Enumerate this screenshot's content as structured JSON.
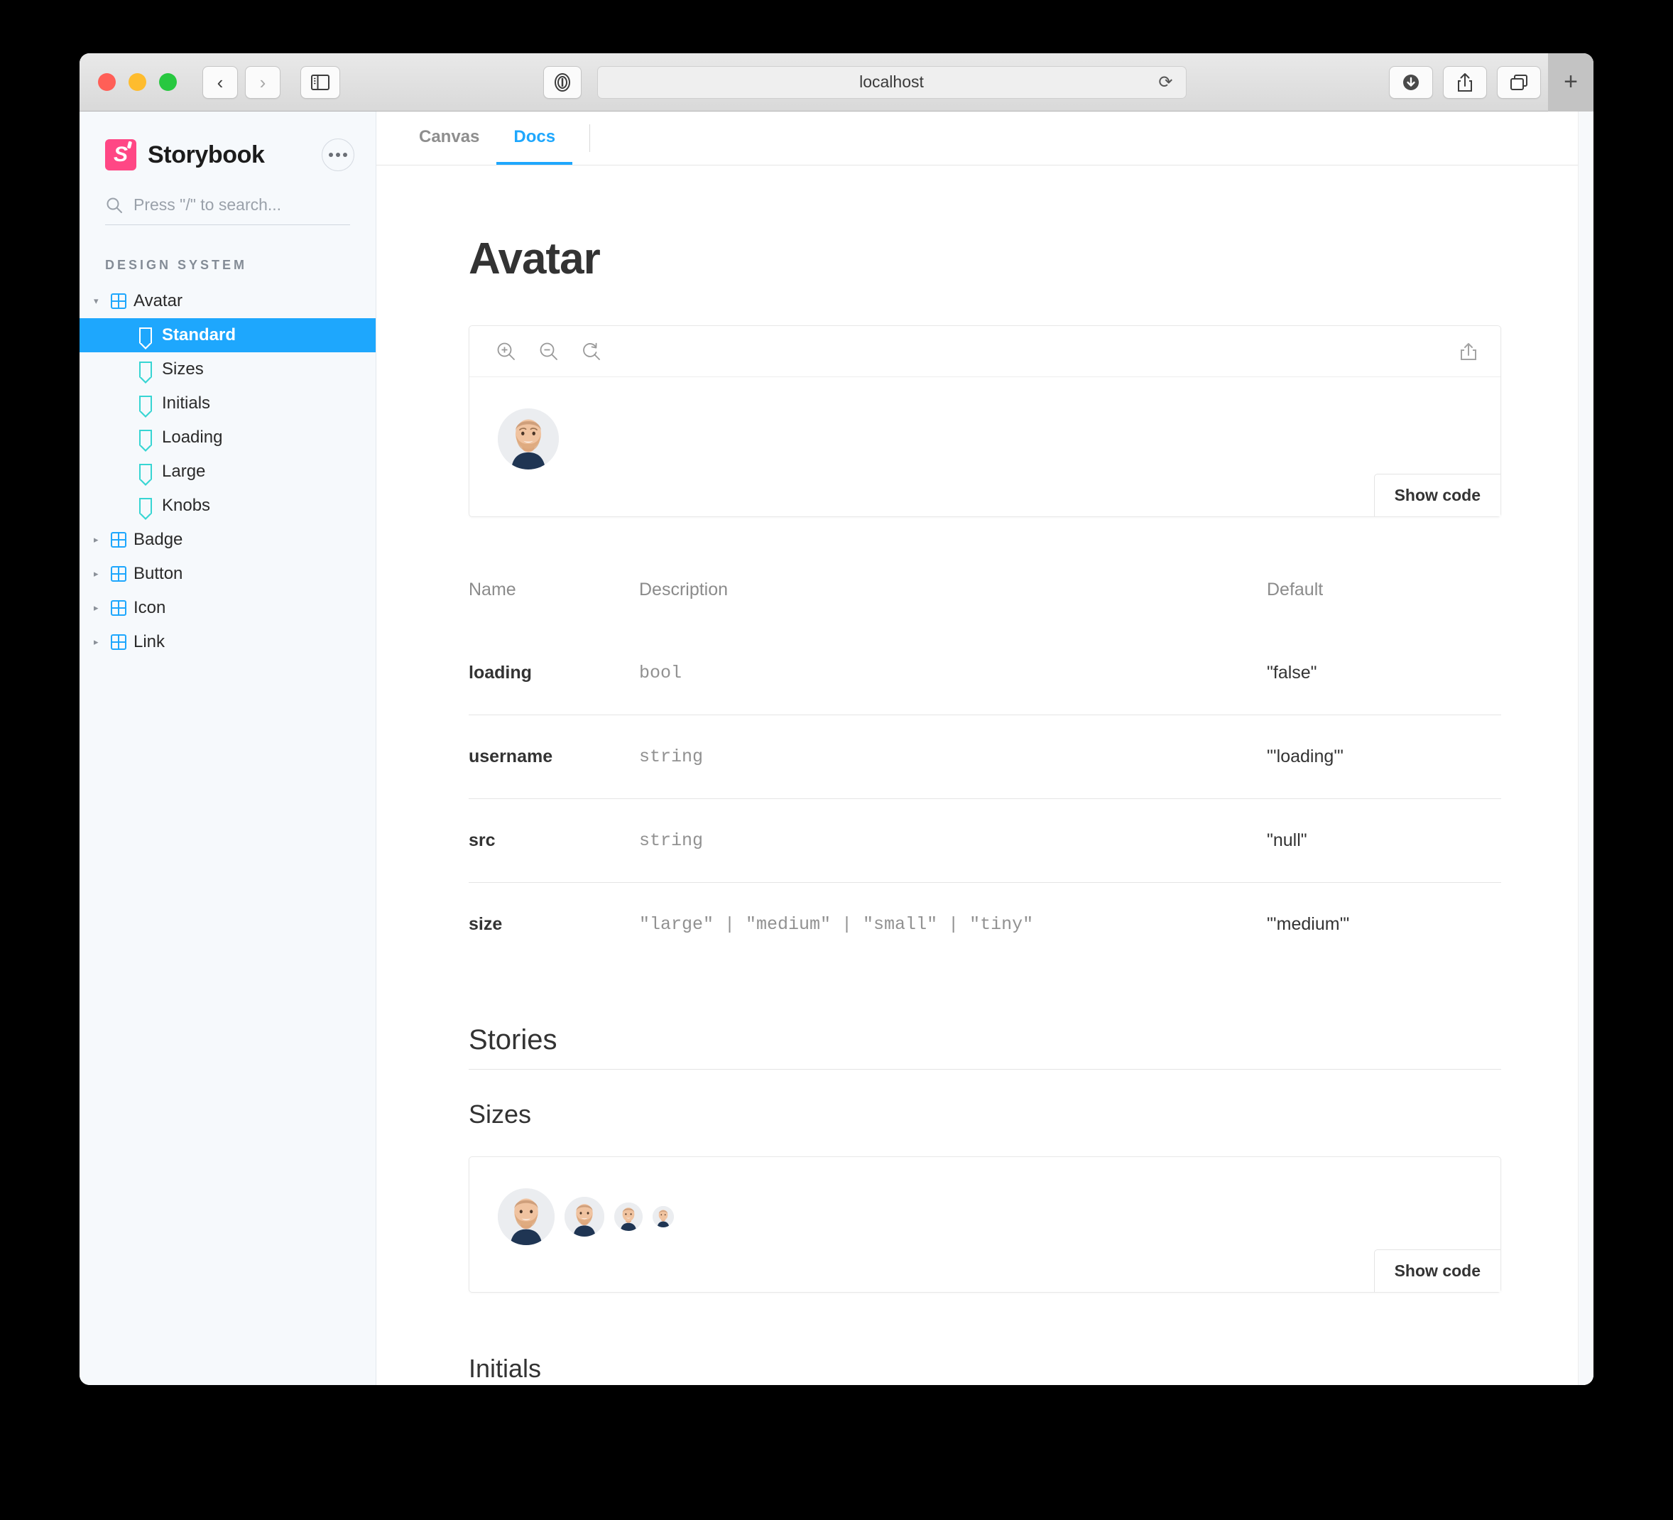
{
  "browser": {
    "url": "localhost",
    "traffic_lights": [
      "close",
      "minimize",
      "maximize"
    ],
    "back_label": "‹",
    "forward_label": "›",
    "reload_label": "⟳",
    "new_tab_label": "+",
    "icons": {
      "sidebar": "sidebar-toggle-icon",
      "reader": "reader-view-icon",
      "downloads": "downloads-icon",
      "share": "share-icon",
      "tabs": "tab-overview-icon"
    }
  },
  "sidebar": {
    "brand": "Storybook",
    "logo_letter": "S",
    "more_label": "•••",
    "search_placeholder": "Press \"/\" to search...",
    "section_label": "DESIGN SYSTEM",
    "tree": [
      {
        "label": "Avatar",
        "type": "group",
        "expanded": true,
        "arrow": "▾"
      },
      {
        "label": "Standard",
        "type": "story",
        "selected": true
      },
      {
        "label": "Sizes",
        "type": "story",
        "selected": false
      },
      {
        "label": "Initials",
        "type": "story",
        "selected": false
      },
      {
        "label": "Loading",
        "type": "story",
        "selected": false
      },
      {
        "label": "Large",
        "type": "story",
        "selected": false
      },
      {
        "label": "Knobs",
        "type": "story",
        "selected": false
      },
      {
        "label": "Badge",
        "type": "group",
        "expanded": false,
        "arrow": "▸"
      },
      {
        "label": "Button",
        "type": "group",
        "expanded": false,
        "arrow": "▸"
      },
      {
        "label": "Icon",
        "type": "group",
        "expanded": false,
        "arrow": "▸"
      },
      {
        "label": "Link",
        "type": "group",
        "expanded": false,
        "arrow": "▸"
      }
    ]
  },
  "main": {
    "tabs": [
      {
        "label": "Canvas",
        "active": false
      },
      {
        "label": "Docs",
        "active": true
      }
    ],
    "doc_title": "Avatar",
    "preview": {
      "zoom_in": "zoom-in",
      "zoom_out": "zoom-out",
      "zoom_reset": "zoom-reset",
      "open_external": "open-in-new",
      "show_code_label": "Show code"
    },
    "props_table": {
      "headers": [
        "Name",
        "Description",
        "Default"
      ],
      "rows": [
        {
          "name": "loading",
          "description": "bool",
          "default": "\"false\""
        },
        {
          "name": "username",
          "description": "string",
          "default": "\"'loading'\""
        },
        {
          "name": "src",
          "description": "string",
          "default": "\"null\""
        },
        {
          "name": "size",
          "description": "\"large\" | \"medium\" | \"small\" | \"tiny\"",
          "default": "\"'medium'\""
        }
      ]
    },
    "stories_heading": "Stories",
    "stories": [
      {
        "heading": "Sizes",
        "show_code_label": "Show code"
      },
      {
        "heading": "Initials"
      }
    ]
  },
  "colors": {
    "accent": "#1ea7fd",
    "brand": "#ff4785",
    "story_icon": "#37d5d3",
    "sidebar_bg": "#f6f9fc"
  }
}
